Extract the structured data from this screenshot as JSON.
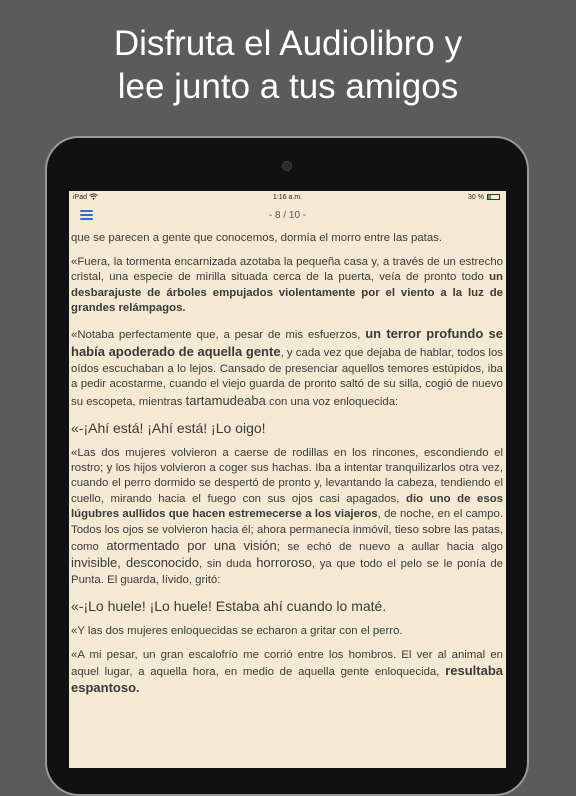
{
  "headline": {
    "line1": "Disfruta el Audiolibro y",
    "line2": "lee junto a tus amigos"
  },
  "statusbar": {
    "device": "iPad",
    "wifi_icon": "wifi-icon",
    "time": "1:16 a.m.",
    "battery_text": "30 %",
    "battery_level": 0.3,
    "battery_color": "#4cae4c"
  },
  "toolbar": {
    "menu_icon": "hamburger-menu-icon",
    "page_indicator": "- 8 / 10 -",
    "accent": "#2b6fd1"
  },
  "content": {
    "p1": "que se parecen a gente que conocemos, dormía el morro entre las patas.",
    "p2a": "«Fuera, la tormenta encarnizada azotaba la pequeña casa y, a través de un estrecho cristal, una especie de mirilla situada cerca de la puerta, veía de pronto todo ",
    "p2b": "un desbarajuste de árboles empujados violentamente por el viento a la luz de grandes relámpagos.",
    "p3a": "«Notaba perfectamente que, a pesar de mis esfuerzos, ",
    "p3b": "un terror profundo se había apoderado de aquella gente",
    "p3c": ", y cada vez que dejaba de hablar, todos los oídos escuchaban a lo lejos. Cansado de presenciar aquellos temores estúpidos, iba a pedir acostarme, cuando el viejo guarda de pronto saltó de su silla, cogió de nuevo su escopeta, mientras ",
    "p3d": "tartamudeaba",
    "p3e": " con una voz enloquecida:",
    "p4": "«-¡Ahí está! ¡Ahí está! ¡Lo oigo!",
    "p5a": "«Las dos mujeres volvieron a caerse de rodillas en los rincones, escondiendo el rostro; y los hijos volvieron a coger sus hachas. Iba a intentar tranquilizarlos otra vez, cuando el perro dormido se despertó de pronto y, levantando la cabeza, tendiendo el cuello, mirando hacia el fuego con sus ojos casi apagados, ",
    "p5b": "dio uno de esos lúgubres aullidos que hacen estremecerse a los viajeros",
    "p5c": ", de noche, en el campo. Todos los ojos se volvieron hacia él; ahora permanecía inmóvil, tieso sobre las patas, como ",
    "p5d": "atormentado por una visión",
    "p5e": "; se echó de nuevo a aullar hacia algo ",
    "p5f": "invisible, desconocido",
    "p5g": ", sin duda ",
    "p5h": "horroroso",
    "p5i": ", ya que todo el pelo se le ponía de Punta. El guarda, lívido, gritó:",
    "p6": "«-¡Lo huele! ¡Lo huele! Estaba ahí cuando lo maté.",
    "p7": "«Y las dos mujeres enloquecidas se echaron a gritar con el perro.",
    "p8a": "«A mi pesar, un gran escalofrío me corrió entre los hombros. El ver al animal en aquel lugar, a aquella hora, en medio de aquella gente enloquecida, ",
    "p8b": "resultaba espantoso."
  }
}
